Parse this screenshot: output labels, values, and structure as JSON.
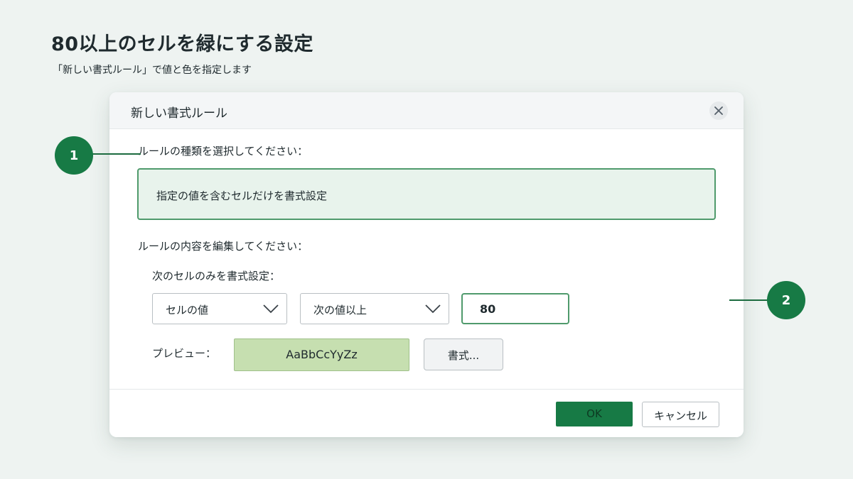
{
  "page": {
    "title": "80以上のセルを緑にする設定",
    "subtitle": "「新しい書式ルール」で値と色を指定します"
  },
  "dialog": {
    "title": "新しい書式ルール",
    "close_icon": "close-icon",
    "rule_type_label": "ルールの種類を選択してください：",
    "rule_type_selected": "指定の値を含むセルだけを書式設定",
    "rule_content_label": "ルールの内容を編集してください：",
    "format_only_label": "次のセルのみを書式設定：",
    "condition_target": "セルの値",
    "condition_operator": "次の値以上",
    "condition_value": "80",
    "preview_label": "プレビュー：",
    "preview_text": "AaBbCcYyZz",
    "preview_color": "#c6dfb0",
    "format_button": "書式...",
    "ok_button": "OK",
    "cancel_button": "キャンセル"
  },
  "callouts": {
    "one": "1",
    "two": "2"
  },
  "colors": {
    "accent": "#177a45",
    "background": "#eef3f1",
    "selection_fill": "#e8f3ec",
    "selection_border": "#4f9a6c"
  }
}
